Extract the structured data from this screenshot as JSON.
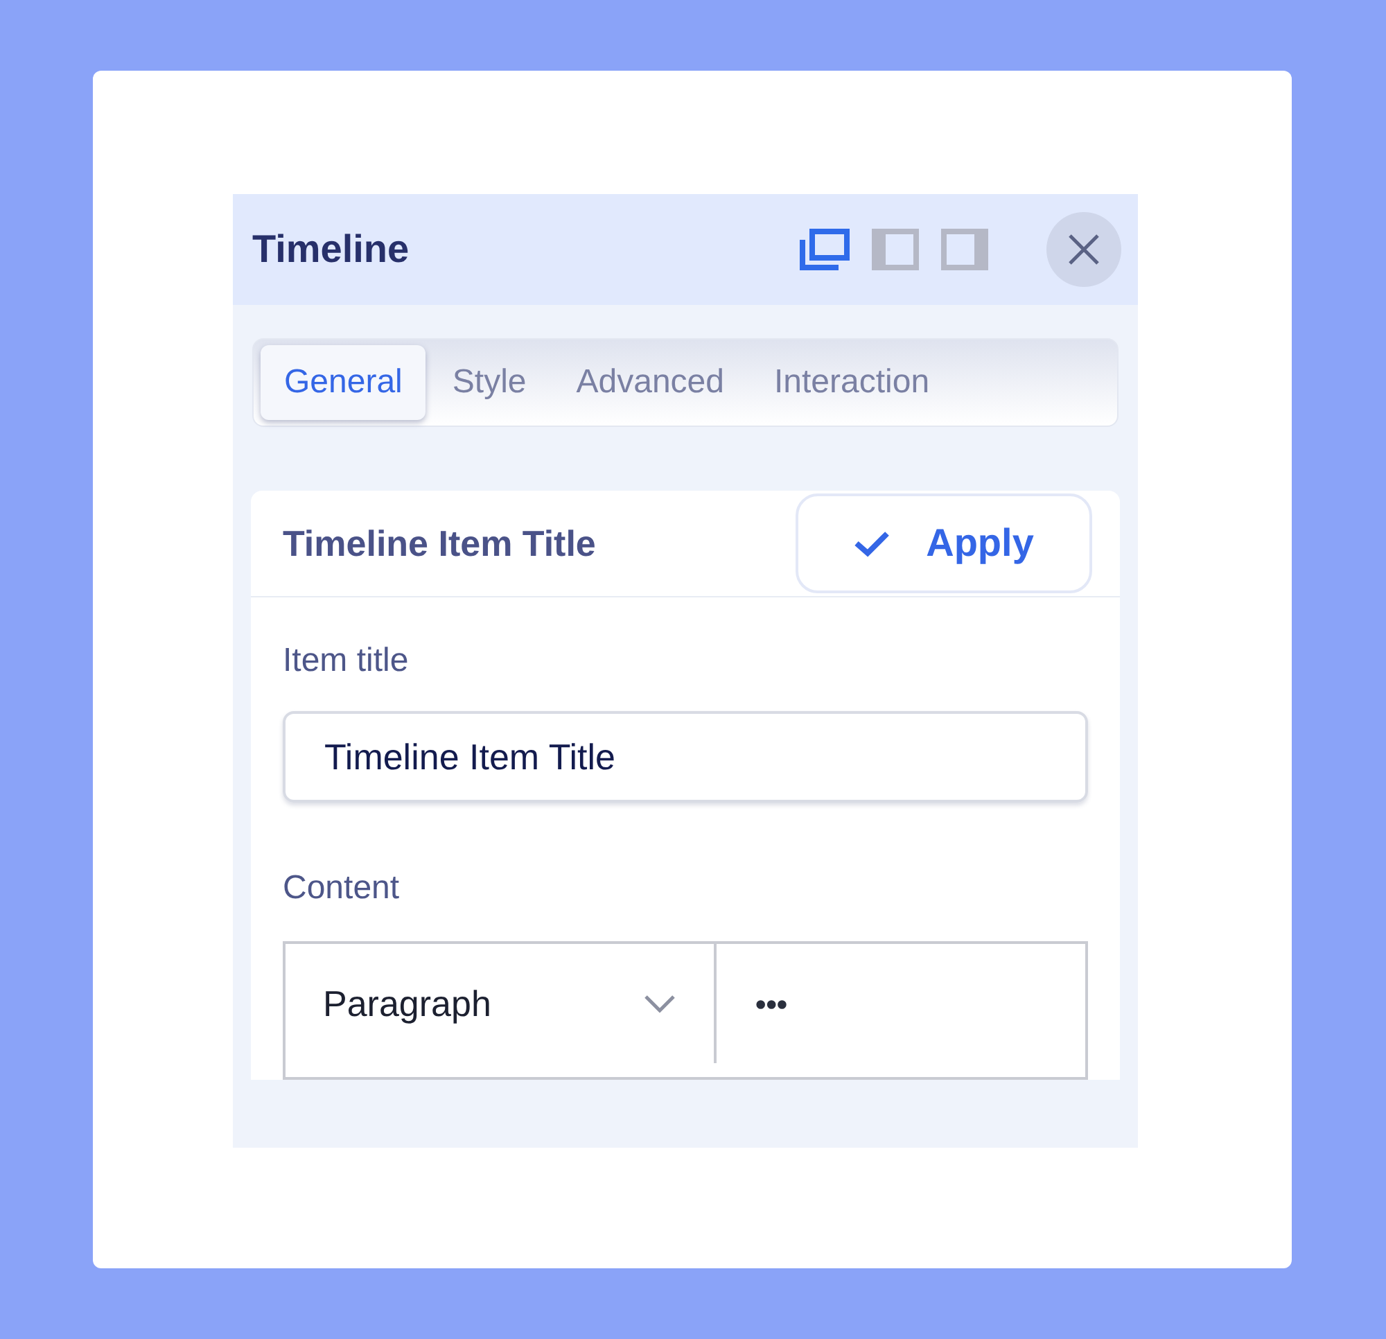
{
  "panel": {
    "title": "Timeline",
    "layouts": [
      {
        "kind": "detached",
        "selected": true
      },
      {
        "kind": "dock-left",
        "selected": false
      },
      {
        "kind": "dock-right",
        "selected": false
      }
    ]
  },
  "tabs": [
    {
      "label": "General",
      "selected": true
    },
    {
      "label": "Style",
      "selected": false
    },
    {
      "label": "Advanced",
      "selected": false
    },
    {
      "label": "Interaction",
      "selected": false
    }
  ],
  "section": {
    "title": "Timeline Item Title",
    "apply_button": "Apply",
    "fields": [
      {
        "label": "Item title",
        "value": "Timeline Item Title"
      }
    ],
    "content": {
      "label": "Content",
      "format": "Paragraph",
      "more": "•••"
    }
  }
}
